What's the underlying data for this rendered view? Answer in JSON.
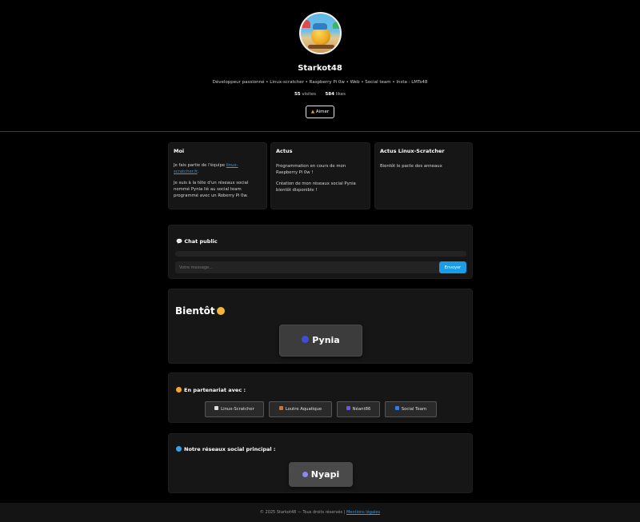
{
  "profile": {
    "username": "Starkot48",
    "bio": "Développeur passionné • Linux-scratcher • Raspberry Pi 0w • Web • Social team • Insta : LMTs48",
    "visits_count": "55",
    "visits_label": "visites",
    "likes_count": "584",
    "likes_label": "likes",
    "like_button": "Aimer",
    "like_icon": "fire-icon"
  },
  "cards": {
    "moi": {
      "title": "Moi",
      "p1_prefix": "Je fais partie de l'équipe ",
      "p1_link": "linux-scratcher.fr",
      "p1_suffix": ".",
      "p2": "Je suis à la tête d'un réseaux social nommé Pynia lié au social team programmé avec un Roberry Pi 0w."
    },
    "actus": {
      "title": "Actus",
      "p1": "Programmation en cours de mon Raspberry Pi 0w !",
      "p2": "Création de mon réseaux social Pynia bientôt disponible !"
    },
    "linux": {
      "title": "Actus Linux-Scratcher",
      "p1": "Bientôt le pacte des anneaux"
    }
  },
  "chat": {
    "title": "💬 Chat public",
    "placeholder": "Votre message...",
    "send_label": "Envoyer"
  },
  "soon": {
    "title": "Bientôt",
    "pynia_label": "Pynia"
  },
  "partners": {
    "title": "En partenariat avec :",
    "items": [
      {
        "label": "Linux-Scratcher",
        "icon": "penguin-icon",
        "color": "#dddddd"
      },
      {
        "label": "Loutre Aquatique",
        "icon": "otter-icon",
        "color": "#c8743a"
      },
      {
        "label": "Néant86",
        "icon": "void-icon",
        "color": "#6a5ad6"
      },
      {
        "label": "Social Team",
        "icon": "link-icon",
        "color": "#3a7ae0"
      }
    ]
  },
  "social": {
    "title": "Notre réseaux social principal :",
    "nyapi_label": "Nyapi"
  },
  "footer": {
    "text": "© 2025 Starkot48 — Tous droits réservés | ",
    "link": "Mentions légales"
  }
}
